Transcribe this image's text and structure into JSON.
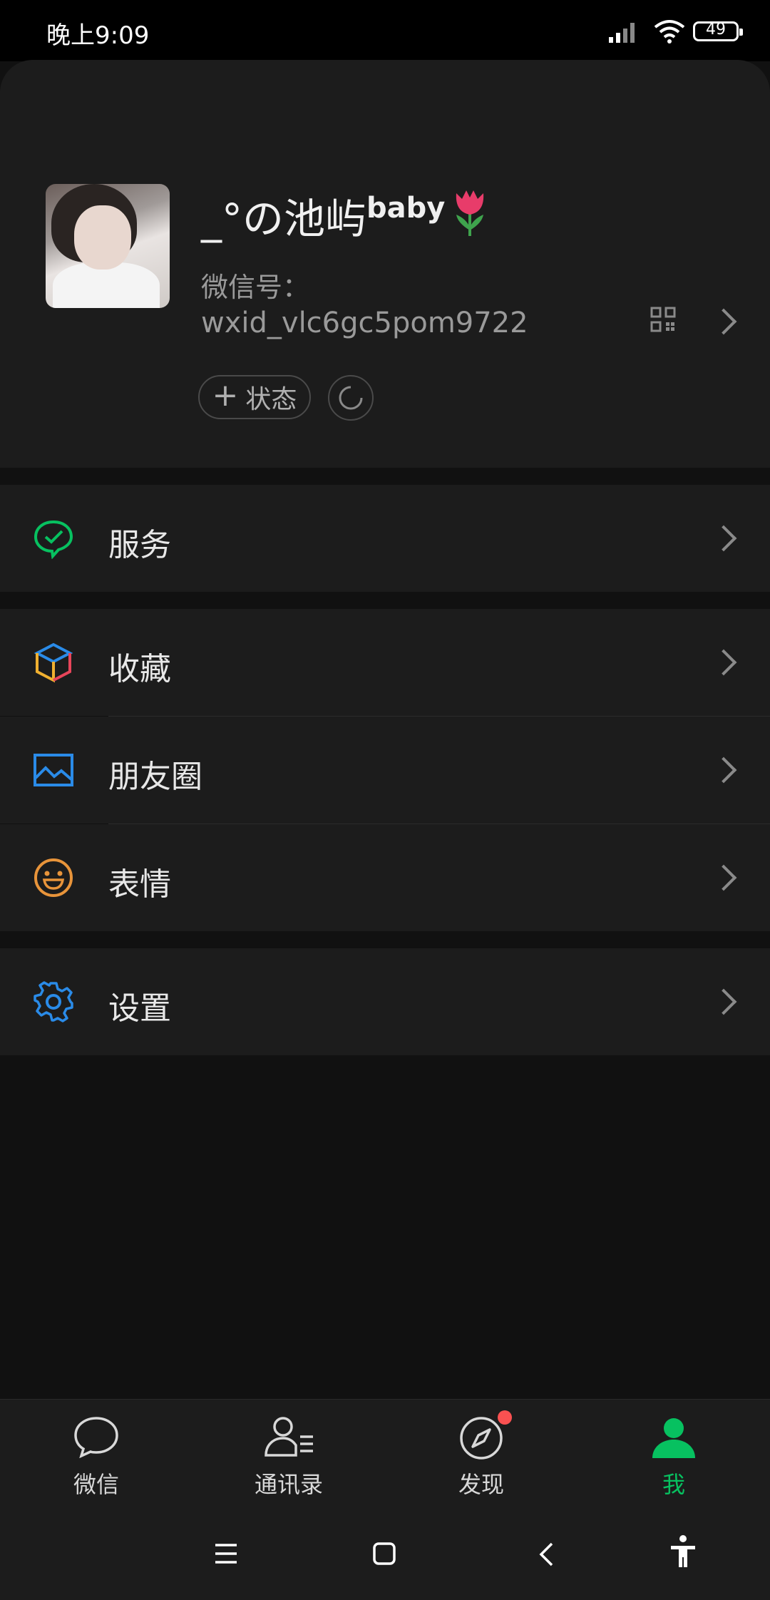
{
  "status_bar": {
    "time": "晚上9:09",
    "battery": "49"
  },
  "profile": {
    "nickname": "_°の池屿",
    "nickname_sup": "baby",
    "wechat_id_label": "微信号：",
    "wechat_id": "wxid_vlc6gc5pom9722",
    "status_button": "状态"
  },
  "menu": {
    "services": "服务",
    "favorites": "收藏",
    "moments": "朋友圈",
    "stickers": "表情",
    "settings": "设置"
  },
  "tabs": [
    {
      "label": "微信"
    },
    {
      "label": "通讯录"
    },
    {
      "label": "发现"
    },
    {
      "label": "我"
    }
  ],
  "colors": {
    "accent": "#07c160",
    "badge": "#fa5151",
    "background": "#111111",
    "surface": "#1c1c1c"
  }
}
